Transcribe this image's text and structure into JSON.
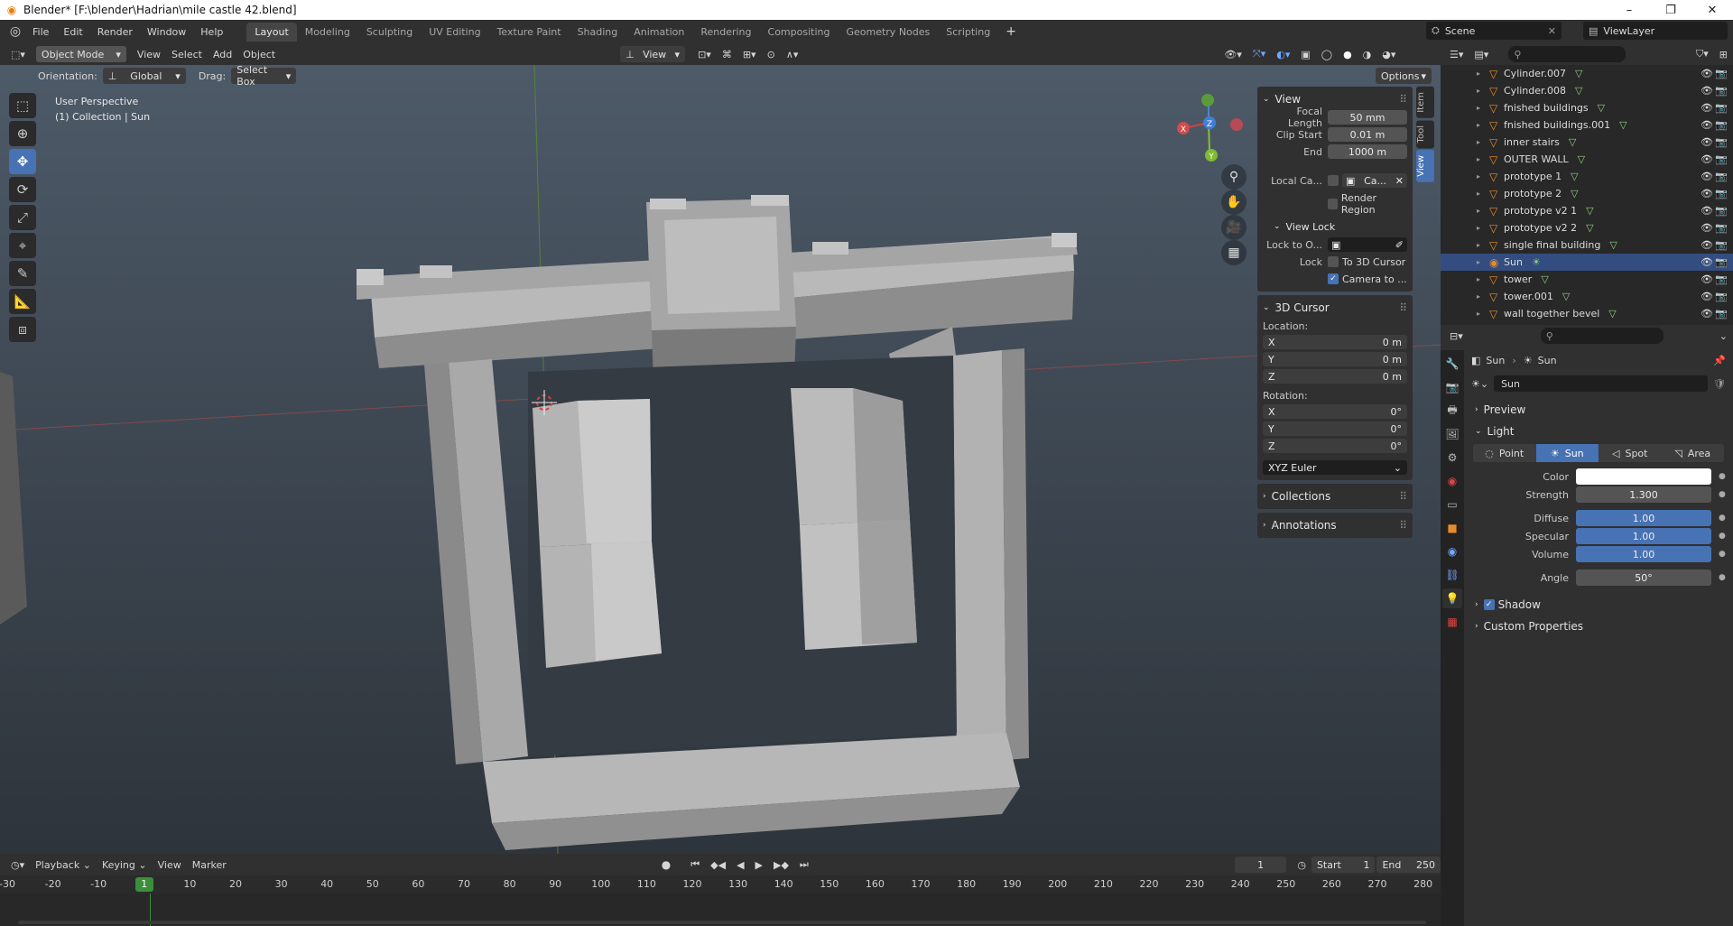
{
  "title_bar": {
    "title": "Blender* [F:\\blender\\Hadrian\\mile castle 42.blend]"
  },
  "menu": {
    "items": [
      "File",
      "Edit",
      "Render",
      "Window",
      "Help"
    ]
  },
  "workspaces": [
    "Layout",
    "Modeling",
    "Sculpting",
    "UV Editing",
    "Texture Paint",
    "Shading",
    "Animation",
    "Rendering",
    "Compositing",
    "Geometry Nodes",
    "Scripting"
  ],
  "active_workspace": "Layout",
  "scene": {
    "name": "Scene",
    "view_layer": "ViewLayer"
  },
  "viewport_header": {
    "mode": "Object Mode",
    "menus": [
      "View",
      "Select",
      "Add",
      "Object"
    ],
    "view_label": "View"
  },
  "tool_options": {
    "orientation_label": "Orientation:",
    "orientation": "Global",
    "drag_label": "Drag:",
    "drag": "Select Box",
    "options": "Options"
  },
  "viewport_info": {
    "line1": "User Perspective",
    "line2": "(1) Collection | Sun"
  },
  "gizmo": {
    "x": "X",
    "y": "Y",
    "z": "Z"
  },
  "npanel": {
    "tabs": [
      "Item",
      "Tool",
      "View"
    ],
    "view": {
      "title": "View",
      "focal_length_label": "Focal Length",
      "focal_length": "50 mm",
      "clip_start_label": "Clip Start",
      "clip_start": "0.01 m",
      "end_label": "End",
      "end": "1000 m",
      "local_camera_label": "Local Ca...",
      "local_camera_value": "Ca...",
      "render_region": "Render Region",
      "view_lock_title": "View Lock",
      "lock_to_label": "Lock to O...",
      "lock_label": "Lock",
      "to_3d_cursor": "To 3D Cursor",
      "camera_to": "Camera to ..."
    },
    "cursor": {
      "title": "3D Cursor",
      "location_label": "Location:",
      "loc": [
        {
          "axis": "X",
          "value": "0 m"
        },
        {
          "axis": "Y",
          "value": "0 m"
        },
        {
          "axis": "Z",
          "value": "0 m"
        }
      ],
      "rotation_label": "Rotation:",
      "rot": [
        {
          "axis": "X",
          "value": "0°"
        },
        {
          "axis": "Y",
          "value": "0°"
        },
        {
          "axis": "Z",
          "value": "0°"
        }
      ],
      "mode": "XYZ Euler"
    },
    "collections": "Collections",
    "annotations": "Annotations"
  },
  "outliner": {
    "items": [
      {
        "name": "Cylinder.007",
        "type": "mesh",
        "selected": false
      },
      {
        "name": "Cylinder.008",
        "type": "mesh",
        "selected": false
      },
      {
        "name": "fnished buildings",
        "type": "mesh",
        "selected": false
      },
      {
        "name": "fnished buildings.001",
        "type": "mesh",
        "selected": false
      },
      {
        "name": "inner stairs",
        "type": "mesh",
        "selected": false
      },
      {
        "name": "OUTER WALL",
        "type": "mesh",
        "selected": false
      },
      {
        "name": "prototype 1",
        "type": "mesh",
        "selected": false
      },
      {
        "name": "prototype 2",
        "type": "mesh",
        "selected": false
      },
      {
        "name": "prototype v2 1",
        "type": "mesh",
        "selected": false
      },
      {
        "name": "prototype v2 2",
        "type": "mesh",
        "selected": false
      },
      {
        "name": "single final building",
        "type": "mesh",
        "selected": false
      },
      {
        "name": "Sun",
        "type": "light",
        "selected": true
      },
      {
        "name": "tower",
        "type": "mesh",
        "selected": false
      },
      {
        "name": "tower.001",
        "type": "mesh",
        "selected": false
      },
      {
        "name": "wall together bevel",
        "type": "mesh",
        "selected": false
      }
    ]
  },
  "properties": {
    "breadcrumb": [
      "Sun",
      "Sun"
    ],
    "datablock": "Sun",
    "preview": "Preview",
    "light": "Light",
    "light_types": [
      "Point",
      "Sun",
      "Spot",
      "Area"
    ],
    "active_light_type": "Sun",
    "color_label": "Color",
    "color": "#ffffff",
    "strength_label": "Strength",
    "strength": "1.300",
    "diffuse_label": "Diffuse",
    "diffuse": "1.00",
    "specular_label": "Specular",
    "specular": "1.00",
    "volume_label": "Volume",
    "volume": "1.00",
    "angle_label": "Angle",
    "angle": "50°",
    "shadow": "Shadow",
    "custom_props": "Custom Properties"
  },
  "timeline": {
    "menus": [
      "Playback",
      "Keying",
      "View",
      "Marker"
    ],
    "current_frame": "1",
    "start_label": "Start",
    "start": "1",
    "end_label": "End",
    "end": "250",
    "ruler": [
      "-30",
      "-20",
      "-10",
      "1",
      "10",
      "20",
      "30",
      "40",
      "50",
      "60",
      "70",
      "80",
      "90",
      "100",
      "110",
      "120",
      "130",
      "140",
      "150",
      "160",
      "170",
      "180",
      "190",
      "200",
      "210",
      "220",
      "230",
      "240",
      "250",
      "260",
      "270",
      "280"
    ]
  }
}
